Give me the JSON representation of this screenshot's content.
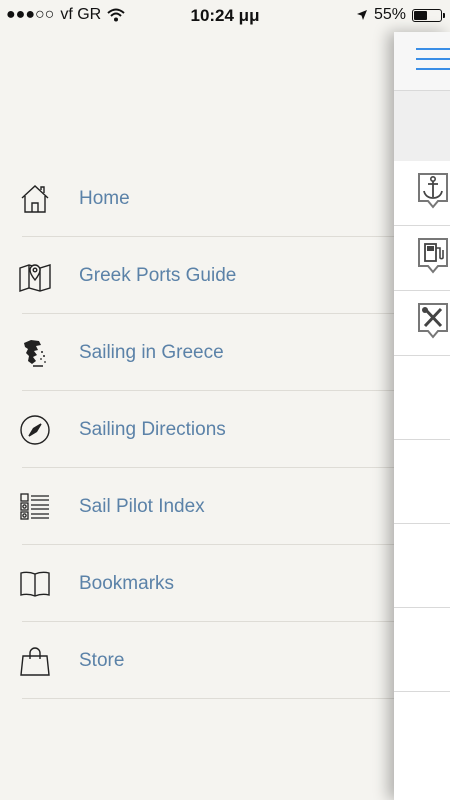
{
  "status_bar": {
    "signal": "●●●○○",
    "carrier": "vf GR",
    "time": "10:24 μμ",
    "battery": "55%",
    "battery_level": 0.55
  },
  "menu": {
    "items": [
      {
        "label": "Home",
        "icon": "home-icon"
      },
      {
        "label": "Greek Ports Guide",
        "icon": "map-pin-icon"
      },
      {
        "label": "Sailing in Greece",
        "icon": "greece-map-icon"
      },
      {
        "label": "Sailing Directions",
        "icon": "compass-icon"
      },
      {
        "label": "Sail Pilot Index",
        "icon": "index-list-icon"
      },
      {
        "label": "Bookmarks",
        "icon": "book-icon"
      },
      {
        "label": "Store",
        "icon": "shopping-bag-icon"
      }
    ]
  },
  "main_panel": {
    "accent_color": "#3a8ee6",
    "rows": [
      "anchor-icon",
      "fuel-icon",
      "tools-icon"
    ]
  }
}
